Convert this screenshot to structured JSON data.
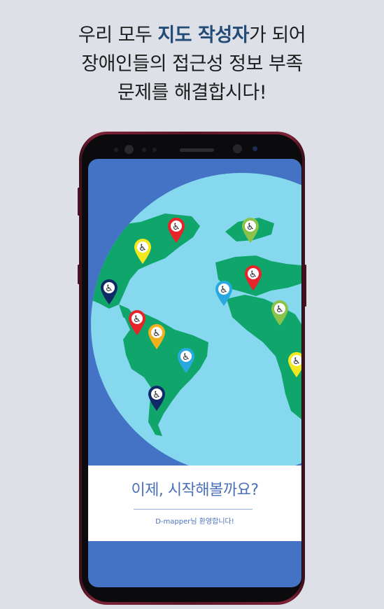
{
  "headline": {
    "line1_before": "우리 모두 ",
    "line1_highlight": "지도 작성자",
    "line1_after": "가 되어",
    "line2": "장애인들의 접근성 정보 부족",
    "line3": "문제를 해결합시다!"
  },
  "screen": {
    "title": "이제, 시작해볼까요?",
    "welcome": "D-mapper님 환영합니다!"
  },
  "colors": {
    "background": "#dde0e7",
    "highlight": "#234b77",
    "screen_blue": "#4472c4",
    "ocean": "#86d8ee",
    "land": "#0fa56b",
    "accent_text": "#4a70b8"
  },
  "map_pins": [
    {
      "color": "#e8242b",
      "icon": "wheelchair-icon"
    },
    {
      "color": "#f2e81f",
      "icon": "wheelchair-icon"
    },
    {
      "color": "#8bc34a",
      "icon": "wheelchair-icon"
    },
    {
      "color": "#0f2a66",
      "icon": "wheelchair-icon"
    },
    {
      "color": "#e8242b",
      "icon": "wheelchair-icon"
    },
    {
      "color": "#29a9e0",
      "icon": "wheelchair-icon"
    },
    {
      "color": "#e8242b",
      "icon": "wheelchair-icon"
    },
    {
      "color": "#8bc34a",
      "icon": "wheelchair-icon"
    },
    {
      "color": "#f2b01e",
      "icon": "wheelchair-icon"
    },
    {
      "color": "#29a9e0",
      "icon": "wheelchair-icon"
    },
    {
      "color": "#f2e81f",
      "icon": "wheelchair-icon"
    },
    {
      "color": "#0f2a66",
      "icon": "wheelchair-icon"
    }
  ]
}
